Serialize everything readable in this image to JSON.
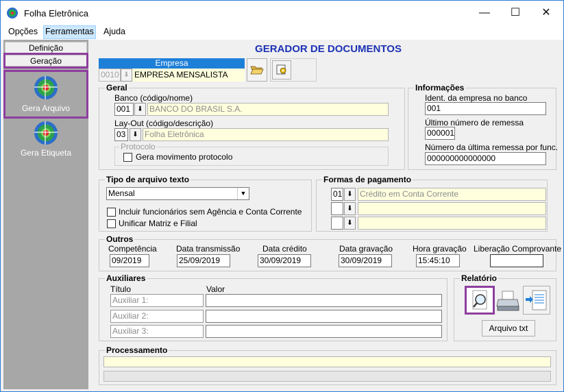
{
  "window": {
    "title": "Folha Eletrônica",
    "controls": {
      "minimize": "—",
      "maximize": "☐",
      "close": "✕"
    }
  },
  "menu": [
    "Opções",
    "Ferramentas",
    "Ajuda"
  ],
  "sidebar": {
    "tabs": [
      "Definição",
      "Geração"
    ],
    "items": [
      {
        "label": "Gera Arquivo",
        "icon": "globe-icon"
      },
      {
        "label": "Gera Etiqueta",
        "icon": "globe-icon"
      }
    ]
  },
  "main": {
    "title": "GERADOR DE DOCUMENTOS",
    "empresa": {
      "header": "Empresa",
      "code": "0010",
      "name": "EMPRESA MENSALISTA"
    },
    "geral": {
      "title": "Geral",
      "banco_label": "Banco (código/nome)",
      "banco_code": "001",
      "banco_name": "BANCO DO BRASIL S.A.",
      "layout_label": "Lay-Out (código/descrição)",
      "layout_code": "03",
      "layout_name": "Folha Eletrônica",
      "protocolo_title": "Protocolo",
      "protocolo_check_label": "Gera movimento protocolo"
    },
    "informacoes": {
      "title": "Informações",
      "ident_label": "Ident. da empresa no banco",
      "ident_value": "001",
      "ultimo_label": "Último número de remessa",
      "ultimo_value": "000001",
      "numero_label": "Número da última remessa por func.",
      "numero_value": "000000000000000"
    },
    "tipo_arquivo": {
      "title": "Tipo de arquivo texto",
      "selected": "Mensal",
      "check1": "Incluir funcionários sem Agência e Conta Corrente",
      "check2": "Unificar Matriz e Filial"
    },
    "formas_pagamento": {
      "title": "Formas de pagamento",
      "rows": [
        {
          "code": "01",
          "desc": "Crédito em Conta Corrente"
        },
        {
          "code": "",
          "desc": ""
        },
        {
          "code": "",
          "desc": ""
        }
      ]
    },
    "outros": {
      "title": "Outros",
      "fields": [
        {
          "label": "Competência",
          "value": "09/2019"
        },
        {
          "label": "Data transmissão",
          "value": "25/09/2019"
        },
        {
          "label": "Data crédito",
          "value": "30/09/2019"
        },
        {
          "label": "Data gravação",
          "value": "30/09/2019"
        },
        {
          "label": "Hora gravação",
          "value": "15:45:10"
        },
        {
          "label": "Liberação Comprovante",
          "value": ""
        }
      ]
    },
    "auxiliares": {
      "title": "Auxiliares",
      "col_titulo": "Título",
      "col_valor": "Valor",
      "rows": [
        "Auxiliar 1:",
        "Auxiliar 2:",
        "Auxiliar 3:"
      ]
    },
    "relatorio": {
      "title": "Relatório",
      "arquivo_btn": "Arquivo txt"
    },
    "processamento": {
      "title": "Processamento"
    }
  },
  "colors": {
    "accent_purple": "#8e3e9e",
    "title_blue": "#1c32b5",
    "header_blue": "#1e7fd8",
    "yellow_field": "#ffffde"
  }
}
